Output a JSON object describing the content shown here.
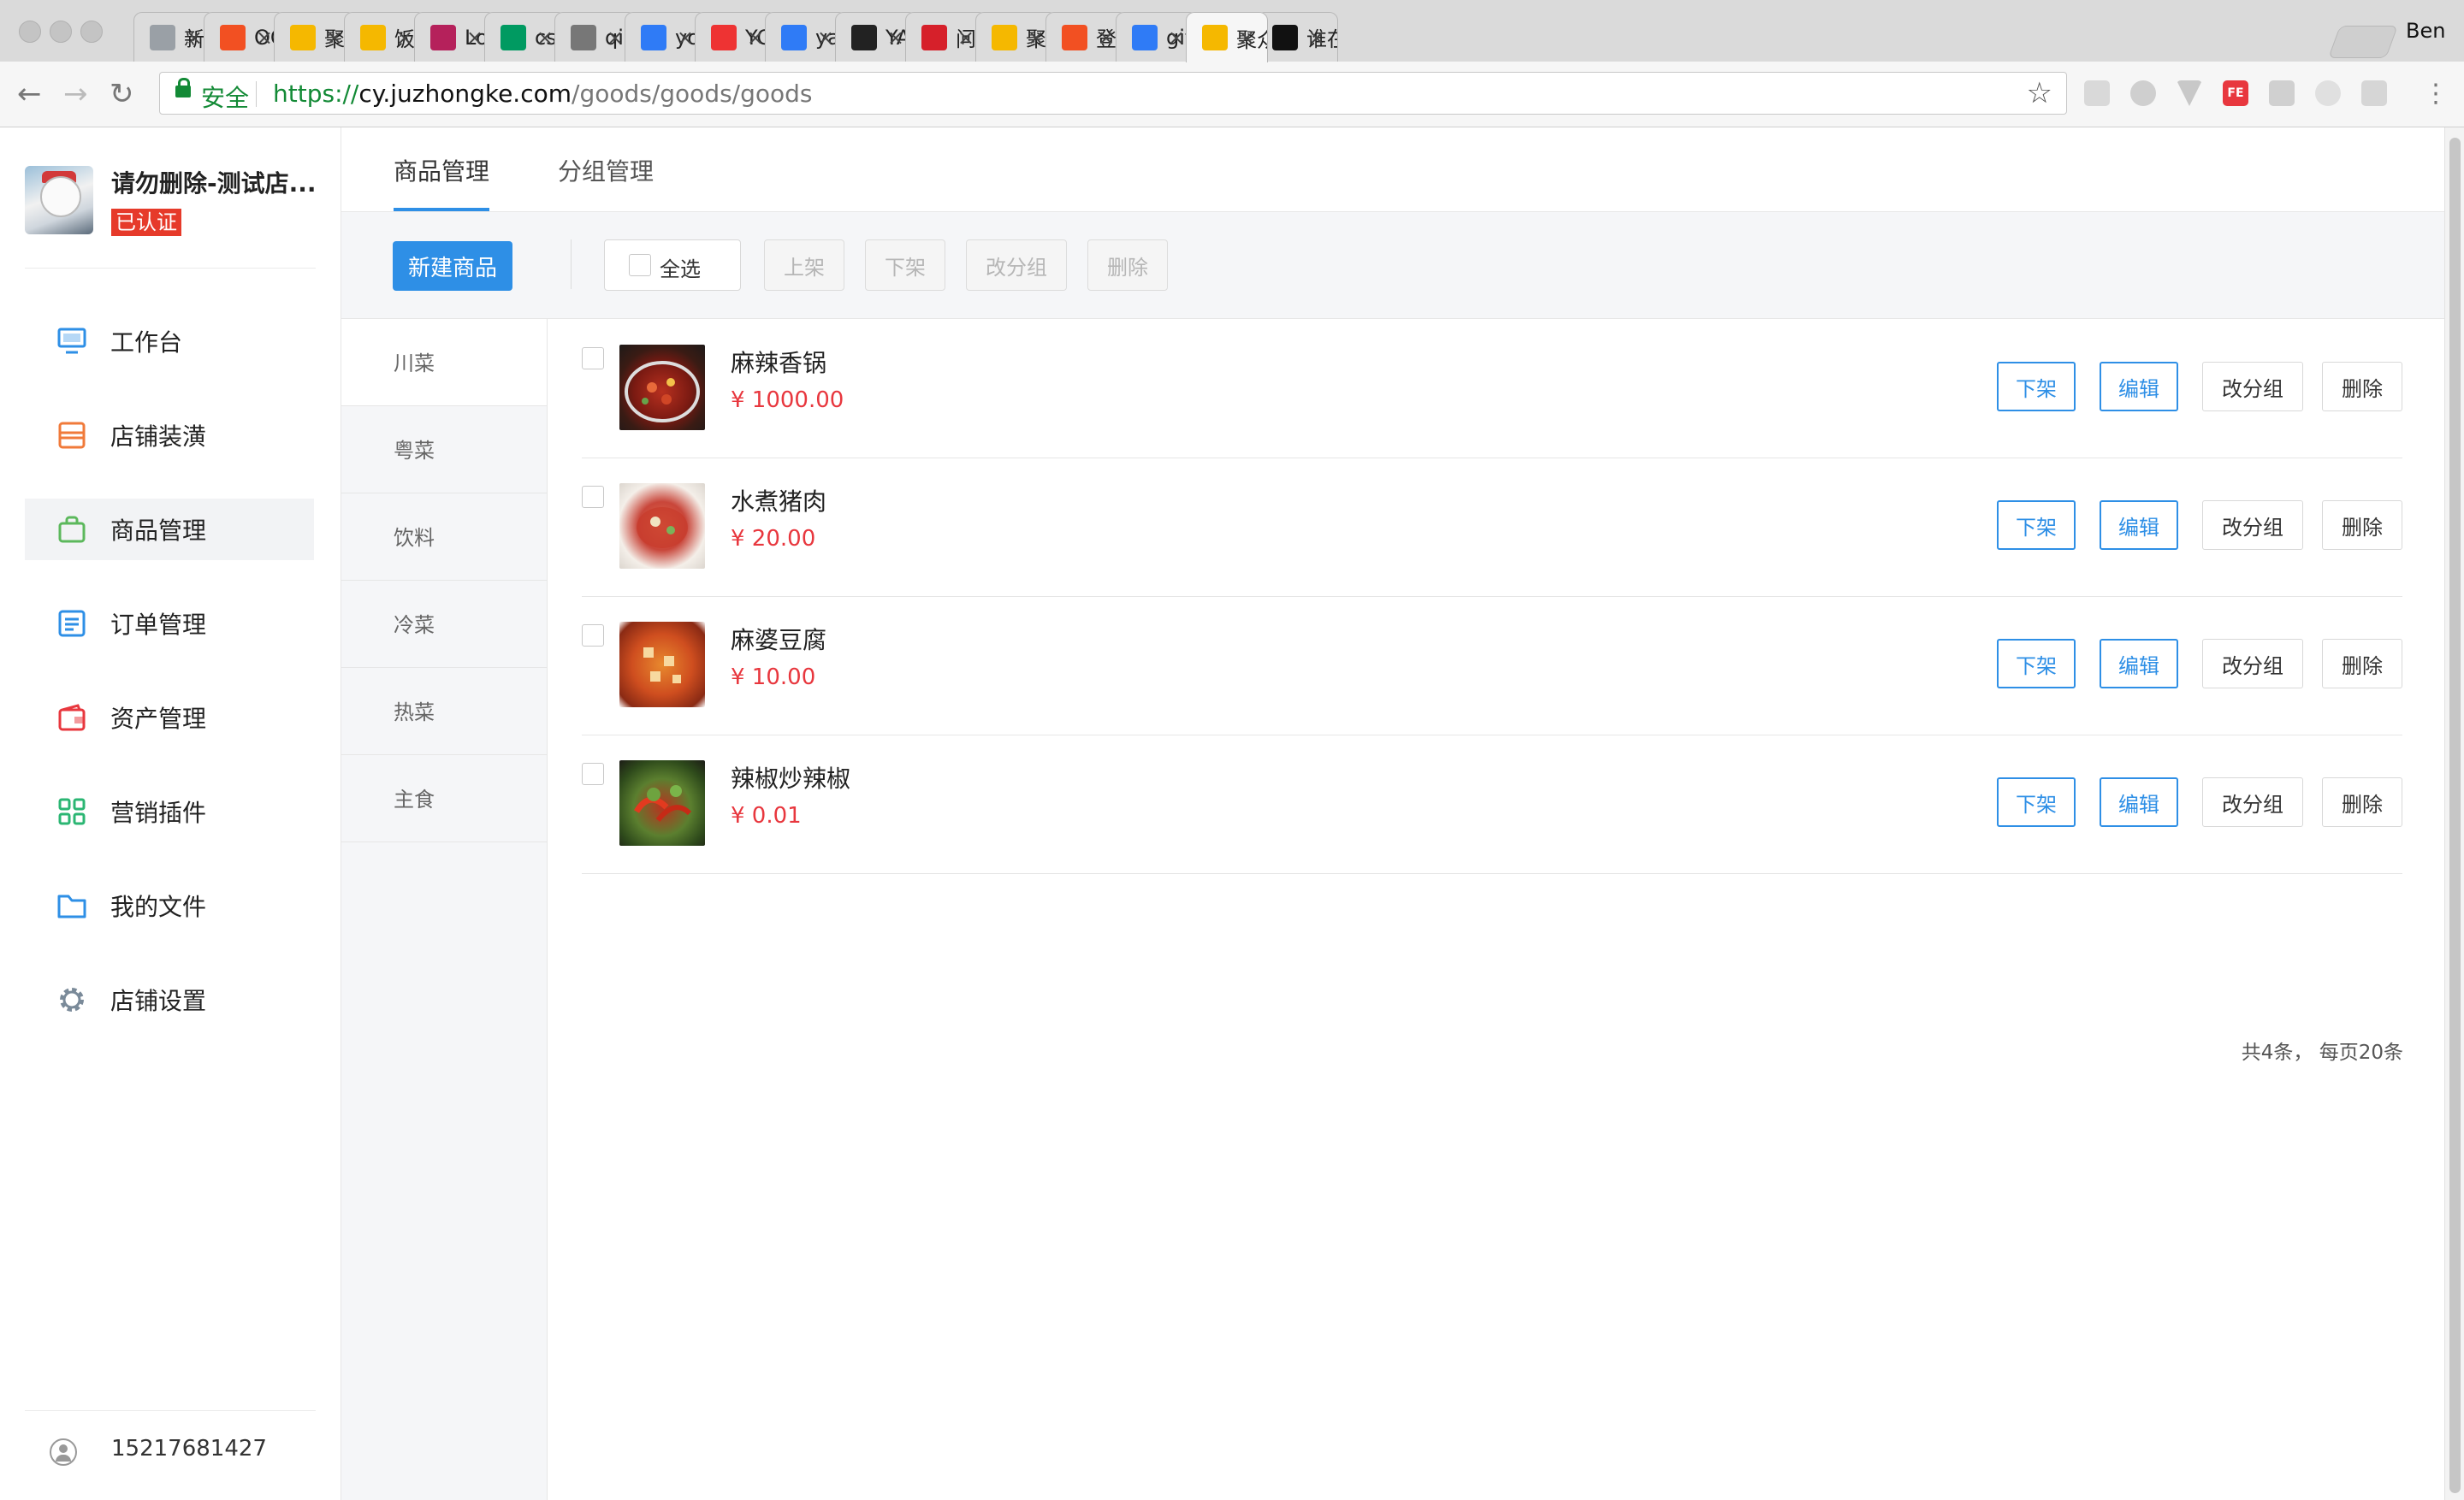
{
  "browser": {
    "tabs": [
      {
        "title": "新标签页",
        "icon": "blank",
        "color": "#9aa0a6"
      },
      {
        "title": "OCR",
        "icon": "windows",
        "color": "#f25022"
      },
      {
        "title": "聚众",
        "icon": "jzk",
        "color": "#f5b800"
      },
      {
        "title": "饭图",
        "icon": "jzk",
        "color": "#f5b800"
      },
      {
        "title": "Log",
        "icon": "R",
        "color": "#b5215b"
      },
      {
        "title": "css",
        "icon": "sf",
        "color": "#009a61"
      },
      {
        "title": "qian",
        "icon": "doc",
        "color": "#777777"
      },
      {
        "title": "yog",
        "icon": "paw",
        "color": "#2f7bf6"
      },
      {
        "title": "YOG",
        "icon": "FEX",
        "color": "#e33"
      },
      {
        "title": "yam",
        "icon": "paw",
        "color": "#2f7bf6"
      },
      {
        "title": "YAM",
        "icon": "script",
        "color": "#222"
      },
      {
        "title": "问题",
        "icon": "arc",
        "color": "#d6202a"
      },
      {
        "title": "聚众",
        "icon": "jzk",
        "color": "#f5b800"
      },
      {
        "title": "登录",
        "icon": "windows",
        "color": "#f25022"
      },
      {
        "title": "gitig",
        "icon": "paw",
        "color": "#2f7bf6"
      },
      {
        "title": "聚众",
        "icon": "jzk",
        "color": "#f5b800"
      },
      {
        "title": "谁在",
        "icon": "github",
        "color": "#111"
      }
    ],
    "profile_name": "Ben",
    "secure_label": "安全",
    "url_proto": "https://",
    "url_host": "cy.juzhongke.com",
    "url_path": "/goods/goods/goods"
  },
  "sidebar": {
    "store_name": "请勿删除-测试店...",
    "verified_badge": "已认证",
    "menu": [
      {
        "label": "工作台",
        "icon": "monitor-icon",
        "color": "#2e8fe6"
      },
      {
        "label": "店铺装潢",
        "icon": "store-icon",
        "color": "#f07a3a"
      },
      {
        "label": "商品管理",
        "icon": "bag-icon",
        "color": "#5cb85c"
      },
      {
        "label": "订单管理",
        "icon": "list-icon",
        "color": "#2e8fe6"
      },
      {
        "label": "资产管理",
        "icon": "wallet-icon",
        "color": "#e8373e"
      },
      {
        "label": "营销插件",
        "icon": "apps-icon",
        "color": "#2bb673"
      },
      {
        "label": "我的文件",
        "icon": "folder-icon",
        "color": "#2e8fe6"
      },
      {
        "label": "店铺设置",
        "icon": "gear-icon",
        "color": "#7a8a99"
      }
    ],
    "user_phone": "15217681427"
  },
  "topnav": {
    "tabs": [
      "商品管理",
      "分组管理"
    ]
  },
  "toolbar": {
    "new_button": "新建商品",
    "select_all": "全选",
    "on_shelf": "上架",
    "off_shelf": "下架",
    "change_group": "改分组",
    "delete": "删除"
  },
  "groups": [
    "川菜",
    "粤菜",
    "饮料",
    "冷菜",
    "热菜",
    "主食"
  ],
  "products": [
    {
      "name": "麻辣香锅",
      "price": "¥ 1000.00"
    },
    {
      "name": "水煮猪肉",
      "price": "¥ 20.00"
    },
    {
      "name": "麻婆豆腐",
      "price": "¥ 10.00"
    },
    {
      "name": "辣椒炒辣椒",
      "price": "¥ 0.01"
    }
  ],
  "row_actions": {
    "off_shelf": "下架",
    "edit": "编辑",
    "change_group": "改分组",
    "delete": "删除"
  },
  "pager": "共4条， 每页20条",
  "colors": {
    "accent": "#2e8fe6",
    "price": "#e8373e"
  }
}
